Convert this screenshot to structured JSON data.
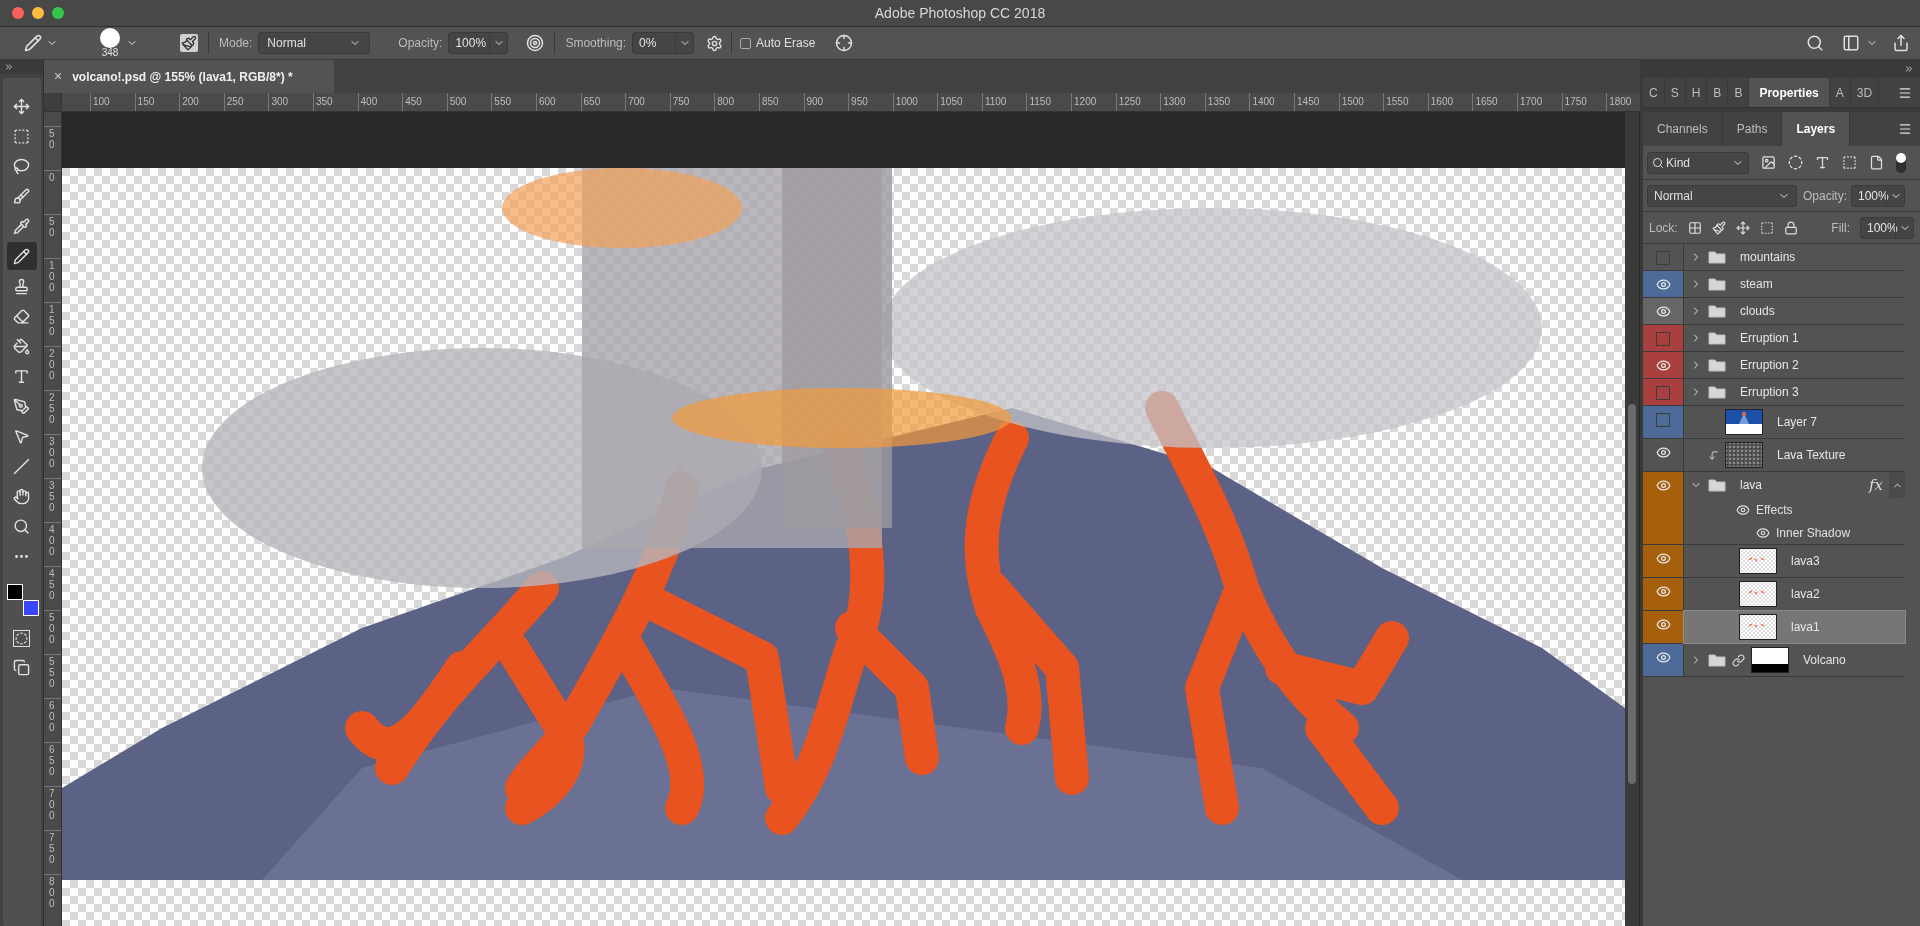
{
  "window": {
    "title": "Adobe Photoshop CC 2018"
  },
  "options_bar": {
    "brush_size": "348",
    "mode_label": "Mode:",
    "mode": "Normal",
    "opacity_label": "Opacity:",
    "opacity": "100%",
    "smoothing_label": "Smoothing:",
    "smoothing": "0%",
    "auto_erase": {
      "label": "Auto Erase",
      "checked": false
    }
  },
  "document_tab": {
    "close": "×",
    "title": "volcano!.psd @ 155% (lava1, RGB/8*) *"
  },
  "tools": [
    {
      "kind": "move",
      "selected": false
    },
    {
      "kind": "marquee",
      "selected": false
    },
    {
      "kind": "lasso",
      "selected": false
    },
    {
      "kind": "quick-select",
      "selected": false
    },
    {
      "kind": "eyedropper",
      "selected": false
    },
    {
      "kind": "pencil",
      "selected": true
    },
    {
      "kind": "stamp",
      "selected": false
    },
    {
      "kind": "eraser",
      "selected": false
    },
    {
      "kind": "bucket",
      "selected": false
    },
    {
      "kind": "type",
      "selected": false
    },
    {
      "kind": "pen",
      "selected": false
    },
    {
      "kind": "select",
      "selected": false
    },
    {
      "kind": "line",
      "selected": false
    },
    {
      "kind": "hand",
      "selected": false
    },
    {
      "kind": "zoom",
      "selected": false
    },
    {
      "kind": "more",
      "selected": false
    }
  ],
  "ruler_h": [
    "100",
    "150",
    "200",
    "250",
    "300",
    "350",
    "400",
    "450",
    "500",
    "550",
    "600",
    "650",
    "700",
    "750",
    "800",
    "850",
    "900",
    "950",
    "1000",
    "1050",
    "1100",
    "1150",
    "1200",
    "1250",
    "1300",
    "1350",
    "1400",
    "1450",
    "1500",
    "1550",
    "1600",
    "1650",
    "1700",
    "1750",
    "1800"
  ],
  "ruler_v": [
    "50",
    "0",
    "50",
    "100",
    "150",
    "200",
    "250",
    "300",
    "350",
    "400",
    "450",
    "500",
    "550",
    "600",
    "650",
    "700",
    "750",
    "800"
  ],
  "panel_tabs_top": [
    {
      "label": "C",
      "selected": false
    },
    {
      "label": "S",
      "selected": false
    },
    {
      "label": "H",
      "selected": false
    },
    {
      "label": "B",
      "selected": false
    },
    {
      "label": "B",
      "selected": false
    },
    {
      "label": "Properties",
      "selected": true
    },
    {
      "label": "A",
      "selected": false
    },
    {
      "label": "3D",
      "selected": false
    }
  ],
  "panel_tabs": [
    {
      "label": "Channels",
      "selected": false
    },
    {
      "label": "Paths",
      "selected": false
    },
    {
      "label": "Layers",
      "selected": true
    }
  ],
  "layers_controls": {
    "filter": "Kind",
    "blend_mode": "Normal",
    "opacity_label": "Opacity:",
    "opacity": "100%",
    "lock_label": "Lock:",
    "fill_label": "Fill:",
    "fill": "100%"
  },
  "layers": [
    {
      "name": "mountains",
      "kind": "group",
      "visible": false,
      "expanded": false,
      "selected": false
    },
    {
      "name": "steam",
      "kind": "group",
      "visible": true,
      "color": "#4d6a98",
      "expanded": false,
      "selected": false
    },
    {
      "name": "clouds",
      "kind": "group",
      "visible": true,
      "color": "#666666",
      "expanded": false,
      "selected": false
    },
    {
      "name": "Erruption 1",
      "kind": "group",
      "visible": false,
      "color": "#a9403f",
      "expanded": false,
      "selected": false
    },
    {
      "name": "Erruption 2",
      "kind": "group",
      "visible": true,
      "color": "#a9403f",
      "expanded": false,
      "selected": false
    },
    {
      "name": "Erruption 3",
      "kind": "group",
      "visible": false,
      "color": "#a9403f",
      "expanded": false,
      "selected": false
    },
    {
      "name": "Layer 7",
      "kind": "layer",
      "thumbnail": {
        "kind": "photo"
      },
      "visible": false,
      "color": "#4d6a98",
      "selected": false
    },
    {
      "name": "Lava Texture",
      "kind": "layer",
      "thumbnail": {
        "kind": "texture"
      },
      "visible": true,
      "selected": false,
      "clipped": true
    },
    {
      "name": "lava",
      "kind": "group",
      "visible": true,
      "color": "#a6600c",
      "expanded": true,
      "selected": false,
      "fx": "fx",
      "effects": [
        {
          "label": "Effects",
          "visible": true,
          "children": [
            {
              "label": "Inner Shadow",
              "visible": true
            }
          ]
        }
      ],
      "children": [
        {
          "name": "lava3",
          "kind": "layer",
          "thumbnail": {
            "kind": "checker"
          },
          "visible": true,
          "color": "#a6600c",
          "selected": false
        },
        {
          "name": "lava2",
          "kind": "layer",
          "thumbnail": {
            "kind": "checker"
          },
          "visible": true,
          "color": "#a6600c",
          "selected": false
        },
        {
          "name": "lava1",
          "kind": "layer",
          "thumbnail": {
            "kind": "checker"
          },
          "visible": true,
          "color": "#a6600c",
          "selected": true
        }
      ]
    },
    {
      "name": "Volcano",
      "kind": "group",
      "visible": true,
      "color": "#4d6a98",
      "expanded": false,
      "selected": false,
      "linked": true,
      "thumbnail": {
        "kind": "mask"
      }
    }
  ]
}
